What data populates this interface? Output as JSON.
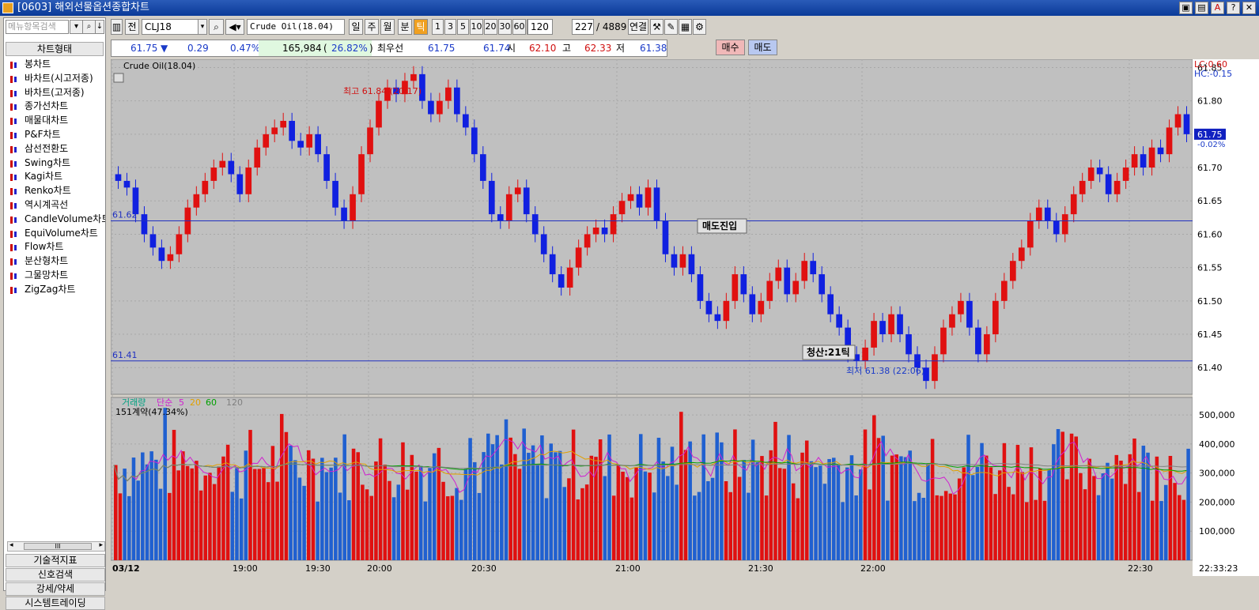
{
  "window": {
    "title": "[0603] 해외선물옵션종합차트"
  },
  "left": {
    "search_placeholder": "메뉴항목검색",
    "section_title": "차트형태",
    "items": [
      "봉차트",
      "바차트(시고저종)",
      "바차트(고저종)",
      "종가선차트",
      "매물대차트",
      "P&F차트",
      "삼선전환도",
      "Swing차트",
      "Kagi차트",
      "Renko차트",
      "역시계곡선",
      "CandleVolume차트",
      "EquiVolume차트",
      "Flow차트",
      "분산형차트",
      "그물망차트",
      "ZigZag차트"
    ],
    "scroll_label": "III",
    "tabs": [
      "기술적지표",
      "신호검색",
      "강세/약세",
      "시스템트레이딩"
    ]
  },
  "toolbar": {
    "prev_label": "전",
    "symbol": "CLJ18",
    "name": "Crude Oil(18.04)",
    "periods": [
      "일",
      "주",
      "월",
      "분",
      "틱"
    ],
    "selected_period": "틱",
    "intervals": [
      "1",
      "3",
      "5",
      "10",
      "20",
      "30",
      "60",
      "120"
    ],
    "selected_interval": "120",
    "interval_value": "120",
    "count": "227",
    "total": "/ 4889",
    "link_label": "연결"
  },
  "quote": {
    "price": "61.75",
    "arrow": "▼",
    "change": "0.29",
    "change_pct": "0.47%",
    "volume": "165,984",
    "vol_pct_open": "(",
    "vol_pct": "26.82%",
    "vol_pct_close": ")",
    "best_label": "최우선",
    "ask": "61.75",
    "bid": "61.74",
    "open_label": "시",
    "open": "62.10",
    "high_label": "고",
    "high": "62.33",
    "low_label": "저",
    "low": "61.38"
  },
  "buy_label": "매수",
  "sell_label": "매도",
  "chart_data": {
    "type": "candlestick",
    "title": "Crude Oil(18.04)",
    "price_axis": {
      "ticks": [
        "61.40",
        "61.45",
        "61.50",
        "61.55",
        "61.60",
        "61.65",
        "61.70",
        "61.75",
        "61.80",
        "61.85"
      ],
      "min": 61.36,
      "max": 61.86
    },
    "lc": "LC:0.60",
    "hc": "HC:-0.15",
    "current": {
      "price": "61.75",
      "pct": "-0.02%"
    },
    "high_annotation": "최고 61.84 (20:17)",
    "low_annotation": "최저 61.38 (22:06)",
    "levels": [
      {
        "value": 61.62,
        "label": "61.62"
      },
      {
        "value": 61.41,
        "label": "61.41"
      }
    ],
    "signals": [
      {
        "label": "매도진입"
      },
      {
        "label": "청산:21틱"
      }
    ],
    "time_ticks": [
      "03/12",
      "19:00",
      "19:30",
      "20:00",
      "20:30",
      "21:00",
      "21:30",
      "22:00",
      "22:30"
    ],
    "time_end": "22:33:23",
    "price_path": [
      61.68,
      61.67,
      61.63,
      61.6,
      61.58,
      61.56,
      61.57,
      61.6,
      61.64,
      61.66,
      61.68,
      61.7,
      61.71,
      61.69,
      61.66,
      61.7,
      61.73,
      61.75,
      61.76,
      61.77,
      61.74,
      61.73,
      61.75,
      61.72,
      61.68,
      61.64,
      61.62,
      61.66,
      61.72,
      61.76,
      61.8,
      61.82,
      61.81,
      61.83,
      61.84,
      61.8,
      61.78,
      61.8,
      61.82,
      61.78,
      61.76,
      61.72,
      61.68,
      61.63,
      61.62,
      61.66,
      61.67,
      61.63,
      61.6,
      61.57,
      61.54,
      61.52,
      61.55,
      61.58,
      61.6,
      61.61,
      61.6,
      61.63,
      61.65,
      61.66,
      61.64,
      61.67,
      61.62,
      61.57,
      61.55,
      61.57,
      61.54,
      61.5,
      61.48,
      61.47,
      61.5,
      61.54,
      61.51,
      61.48,
      61.5,
      61.53,
      61.55,
      61.51,
      61.53,
      61.56,
      61.54,
      61.51,
      61.48,
      61.46,
      61.42,
      61.41,
      61.43,
      61.47,
      61.45,
      61.48,
      61.45,
      61.42,
      61.4,
      61.38,
      61.42,
      61.46,
      61.48,
      61.5,
      61.46,
      61.42,
      61.45,
      61.5,
      61.53,
      61.56,
      61.58,
      61.62,
      61.64,
      61.62,
      61.6,
      61.63,
      61.66,
      61.68,
      61.7,
      61.69,
      61.66,
      61.68,
      61.7,
      61.72,
      61.7,
      61.73,
      61.72,
      61.76,
      61.78,
      61.75
    ],
    "volume": {
      "title": "거래량",
      "ma_label": "단순",
      "ma_periods": [
        "5",
        "20",
        "60",
        "120"
      ],
      "ma_colors": [
        "#d020d0",
        "#e0a000",
        "#00a000",
        "#808080"
      ],
      "last_label": "151계약(47.34%)",
      "ticks": [
        "100,000",
        "200,000",
        "300,000",
        "400,000",
        "500,000"
      ],
      "max": 560000
    }
  }
}
